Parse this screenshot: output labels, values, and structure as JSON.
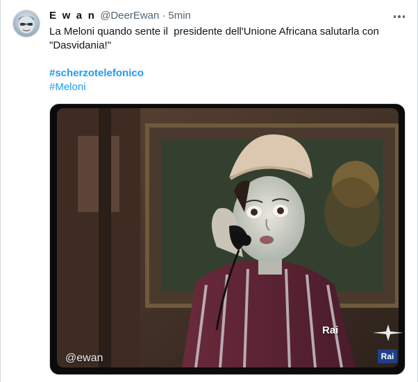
{
  "author": {
    "display_name": "E w a n",
    "handle": "@DeerEwan",
    "separator": "·",
    "time": "5min"
  },
  "tweet": {
    "text": "La Meloni quando sente il  presidente dell'Unione Africana salutarla con \"Dasvidania!\"",
    "hashtags": [
      "#scherzotelefonico",
      "#Meloni"
    ]
  },
  "media": {
    "watermark": "@ewan",
    "broadcaster_logo": "Rai",
    "broadcaster_badge": "Rai"
  },
  "colors": {
    "link": "#1d9bf0",
    "text": "#0f1419",
    "muted": "#536471"
  },
  "icons": {
    "more": "more-horizontal-icon"
  }
}
